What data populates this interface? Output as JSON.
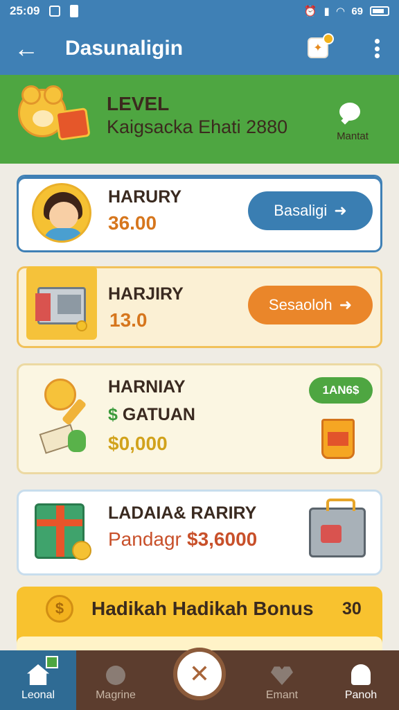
{
  "status_bar": {
    "time": "25:09",
    "battery": "69"
  },
  "app_bar": {
    "back": "←",
    "title": "Dasunaligin",
    "more_label": "more options"
  },
  "level": {
    "label": "LEVEL",
    "text": "Kaigsacka Ehati 2880",
    "chat_label": "Mantat"
  },
  "cards": [
    {
      "title": "HARURY",
      "value": "36.00",
      "button": "Basaligi"
    },
    {
      "title": "HARJIRY",
      "value": "13.0",
      "button": "Sesaoloh"
    },
    {
      "title": "HARNIAY",
      "line2_dollar": "$",
      "line2": "GATUAN",
      "value": "$0,000",
      "badge": "1AN6$"
    },
    {
      "title": "LADAIA& RARIRY",
      "subtitle": "Pandagr",
      "value": "$3,6000"
    }
  ],
  "bonus": {
    "title": "Hadikah Hadikah Bonus",
    "value": "30",
    "coin": "$"
  },
  "nav": {
    "items": [
      {
        "label": "Leonal",
        "icon": "home-icon"
      },
      {
        "label": "Magrine",
        "icon": "person-icon"
      },
      {
        "label": "Emant",
        "icon": "heart-icon"
      },
      {
        "label": "Panoh",
        "icon": "user-icon"
      }
    ],
    "center": "✕"
  },
  "colors": {
    "primary_blue": "#3f80b5",
    "level_green": "#4ea641",
    "accent_orange": "#ea862a",
    "value_orange": "#d6761d",
    "value_gold": "#d1a21c",
    "value_red": "#c8502a",
    "nav_brown": "#5c3d2e"
  }
}
